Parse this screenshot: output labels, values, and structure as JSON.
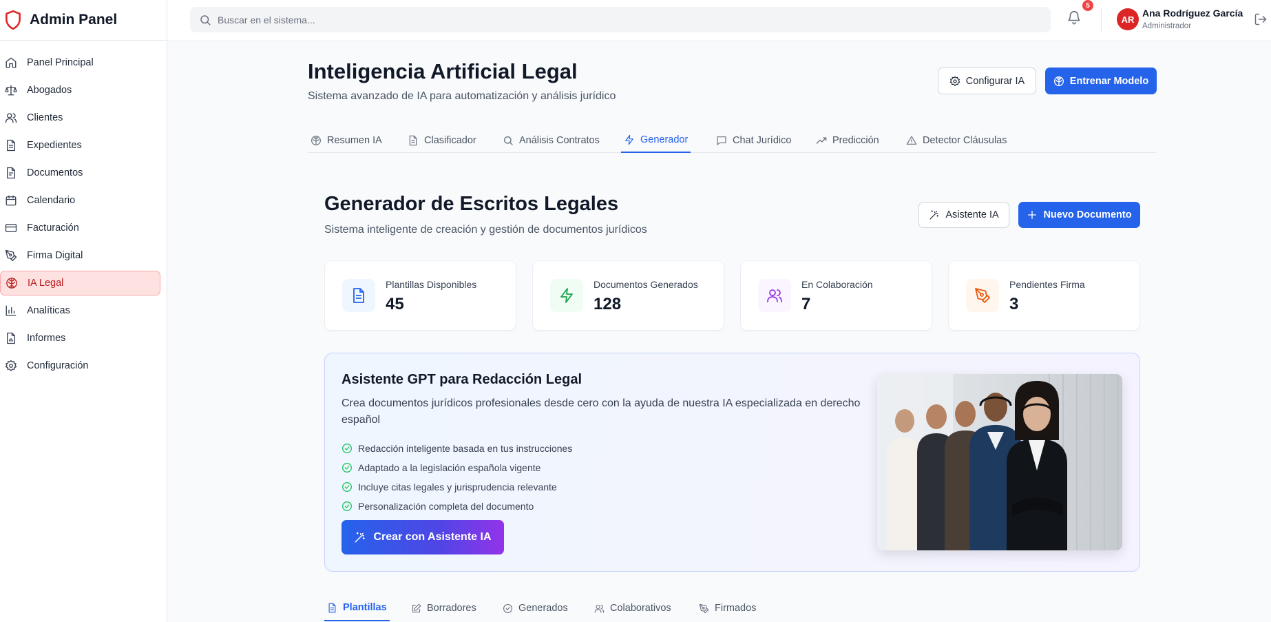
{
  "brand": {
    "name": "Admin Panel",
    "icon": "shield-icon",
    "color": "#dc2626"
  },
  "sidebar": {
    "items": [
      {
        "label": "Panel Principal",
        "icon": "home-icon"
      },
      {
        "label": "Abogados",
        "icon": "scale-icon"
      },
      {
        "label": "Clientes",
        "icon": "users-icon"
      },
      {
        "label": "Expedientes",
        "icon": "file-text-icon"
      },
      {
        "label": "Documentos",
        "icon": "file-icon"
      },
      {
        "label": "Calendario",
        "icon": "calendar-icon"
      },
      {
        "label": "Facturación",
        "icon": "credit-card-icon"
      },
      {
        "label": "Firma Digital",
        "icon": "pen-tool-icon"
      },
      {
        "label": "IA Legal",
        "icon": "brain-icon",
        "active": true
      },
      {
        "label": "Analíticas",
        "icon": "bar-chart-icon"
      },
      {
        "label": "Informes",
        "icon": "report-icon"
      },
      {
        "label": "Configuración",
        "icon": "gear-icon"
      }
    ]
  },
  "topbar": {
    "search_placeholder": "Buscar en el sistema...",
    "notifications_count": "5",
    "user": {
      "initials": "AR",
      "name": "Ana Rodríguez García",
      "role": "Administrador"
    }
  },
  "page": {
    "title": "Inteligencia Artificial Legal",
    "subtitle": "Sistema avanzado de IA para automatización y análisis jurídico",
    "configure_label": "Configurar IA",
    "train_label": "Entrenar Modelo",
    "tabs": [
      {
        "label": "Resumen IA",
        "icon": "brain-icon"
      },
      {
        "label": "Clasificador",
        "icon": "file-text-icon"
      },
      {
        "label": "Análisis Contratos",
        "icon": "search-icon"
      },
      {
        "label": "Generador",
        "icon": "zap-icon",
        "active": true
      },
      {
        "label": "Chat Jurídico",
        "icon": "message-icon"
      },
      {
        "label": "Predicción",
        "icon": "trending-up-icon"
      },
      {
        "label": "Detector Cláusulas",
        "icon": "alert-triangle-icon"
      }
    ]
  },
  "generator": {
    "title": "Generador de Escritos Legales",
    "subtitle": "Sistema inteligente de creación y gestión de documentos jurídicos",
    "assistant_button": "Asistente IA",
    "new_doc_button": "Nuevo Documento",
    "stats": [
      {
        "label": "Plantillas Disponibles",
        "value": "45",
        "icon": "file-text-icon",
        "color": "#2563eb",
        "bg": "#eff6ff"
      },
      {
        "label": "Documentos Generados",
        "value": "128",
        "icon": "zap-icon",
        "color": "#16a34a",
        "bg": "#f0fdf4"
      },
      {
        "label": "En Colaboración",
        "value": "7",
        "icon": "users-icon",
        "color": "#9333ea",
        "bg": "#faf5ff"
      },
      {
        "label": "Pendientes Firma",
        "value": "3",
        "icon": "pen-tool-icon",
        "color": "#ea580c",
        "bg": "#fff7ed"
      }
    ],
    "assistant": {
      "title": "Asistente GPT para Redacción Legal",
      "description": "Crea documentos jurídicos profesionales desde cero con la ayuda de nuestra IA especializada en derecho español",
      "features": [
        "Redacción inteligente basada en tus instrucciones",
        "Adaptado a la legislación española vigente",
        "Incluye citas legales y jurisprudencia relevante",
        "Personalización completa del documento"
      ],
      "cta": "Crear con Asistente IA"
    },
    "subtabs": [
      {
        "label": "Plantillas",
        "icon": "file-text-icon",
        "active": true
      },
      {
        "label": "Borradores",
        "icon": "edit-icon"
      },
      {
        "label": "Generados",
        "icon": "check-circle-icon"
      },
      {
        "label": "Colaborativos",
        "icon": "users-icon"
      },
      {
        "label": "Firmados",
        "icon": "pen-tool-icon"
      }
    ]
  }
}
